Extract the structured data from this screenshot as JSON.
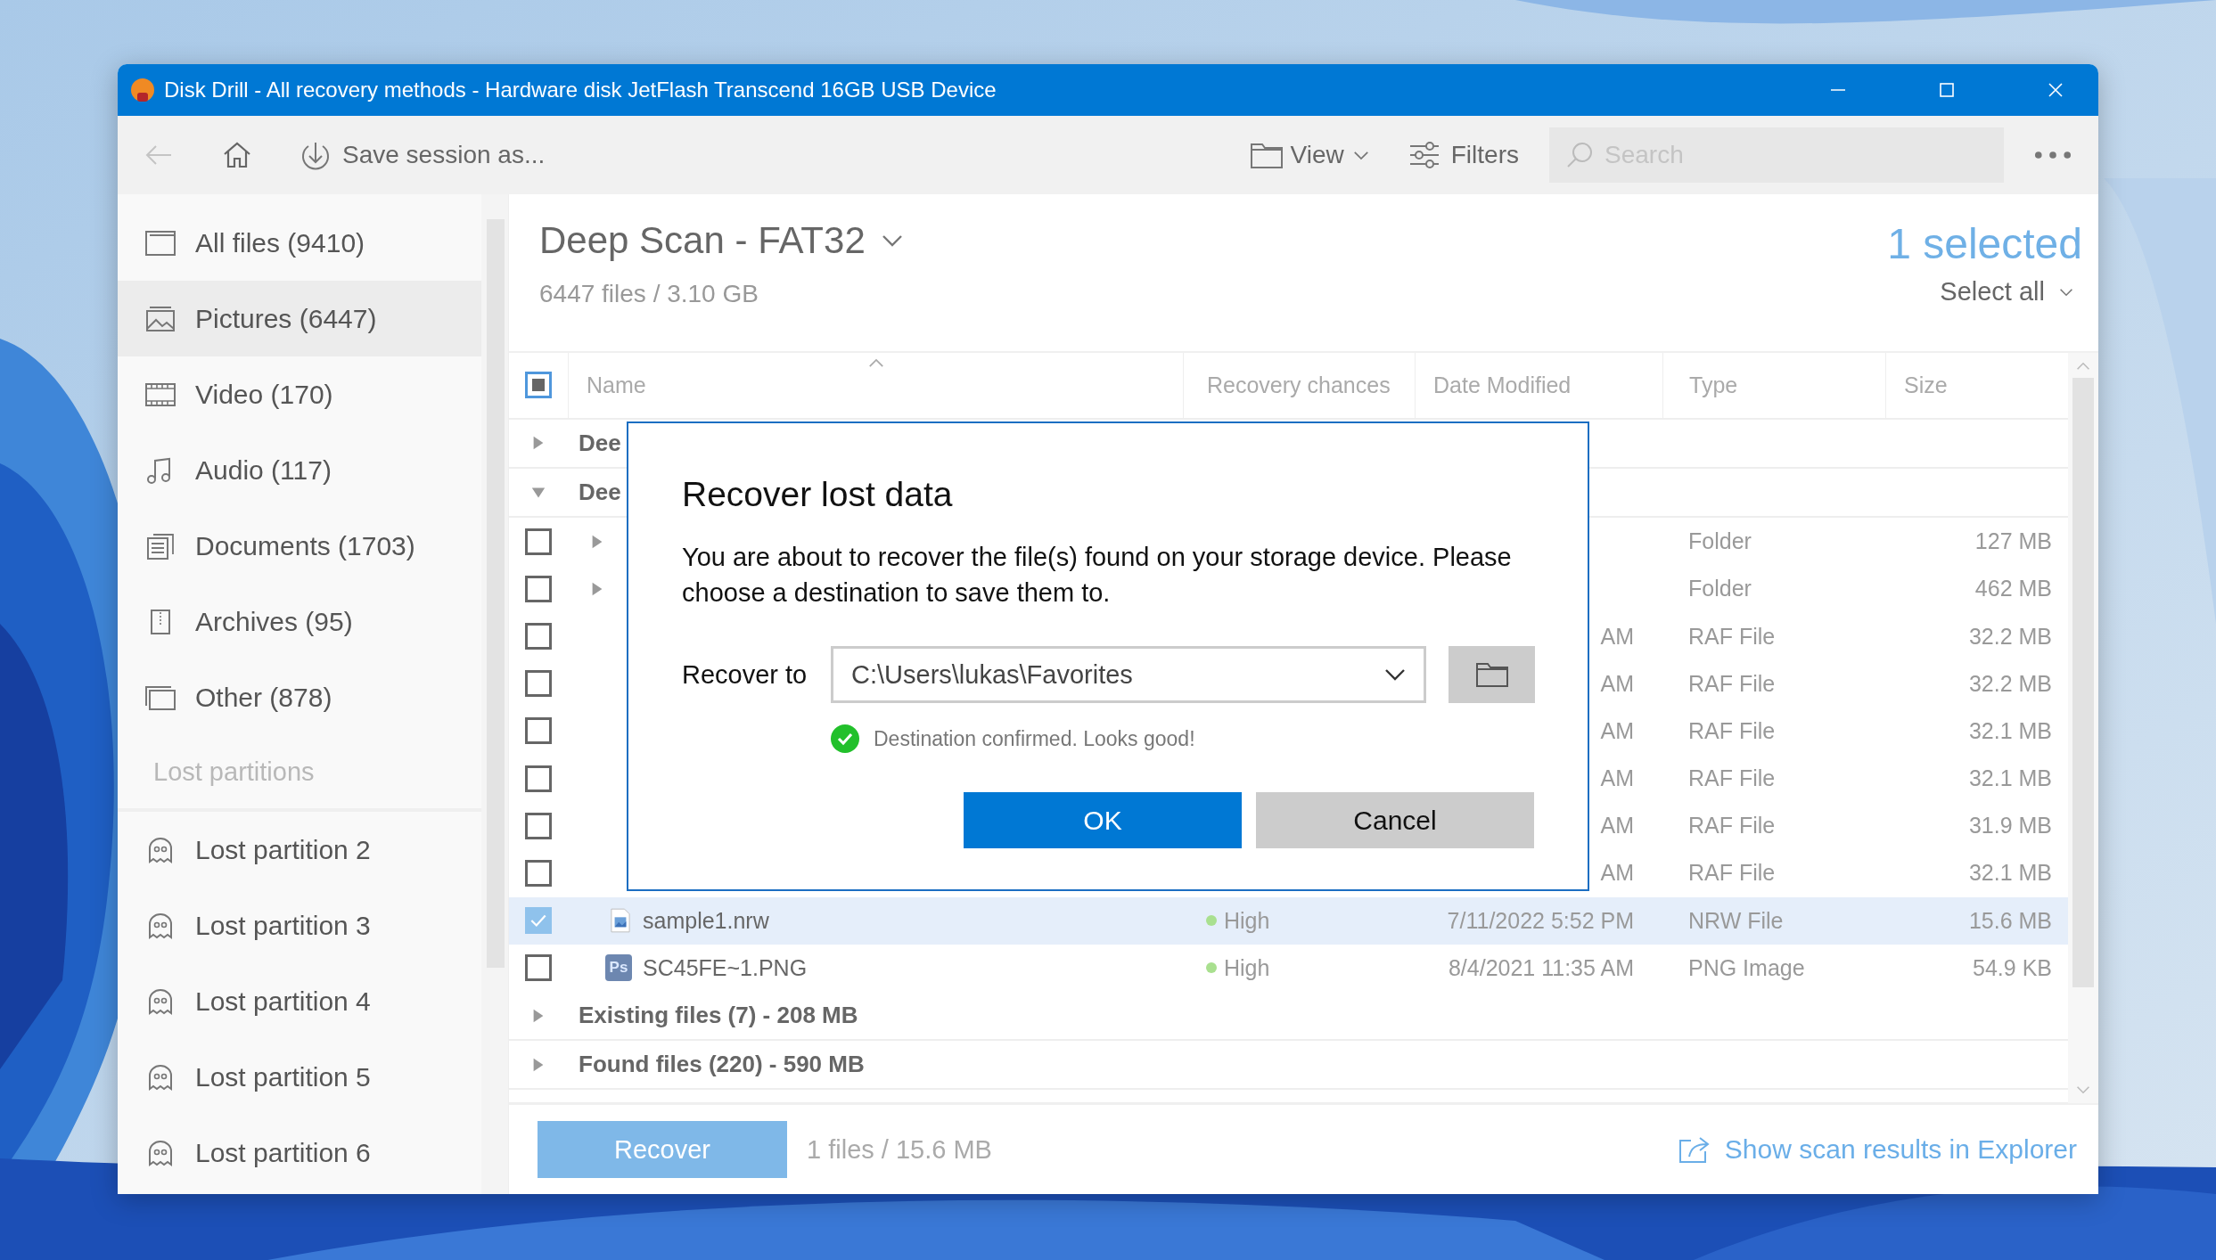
{
  "window": {
    "title": "Disk Drill - All recovery methods - Hardware disk JetFlash Transcend 16GB USB Device"
  },
  "toolbar": {
    "save_session": "Save session as...",
    "view": "View",
    "filters": "Filters",
    "search": {
      "placeholder": "Search"
    }
  },
  "sidebar": {
    "items": [
      {
        "kind": "all",
        "label": "All files (9410)",
        "selected": false
      },
      {
        "kind": "pictures",
        "label": "Pictures (6447)",
        "selected": true
      },
      {
        "kind": "video",
        "label": "Video (170)",
        "selected": false
      },
      {
        "kind": "audio",
        "label": "Audio (117)",
        "selected": false
      },
      {
        "kind": "documents",
        "label": "Documents (1703)",
        "selected": false
      },
      {
        "kind": "archives",
        "label": "Archives (95)",
        "selected": false
      },
      {
        "kind": "other",
        "label": "Other (878)",
        "selected": false
      }
    ],
    "section": "Lost partitions",
    "partitions": [
      {
        "label": "Lost partition 2"
      },
      {
        "label": "Lost partition 3"
      },
      {
        "label": "Lost partition 4"
      },
      {
        "label": "Lost partition 5"
      },
      {
        "label": "Lost partition 6"
      }
    ]
  },
  "scan": {
    "title": "Deep Scan - FAT32",
    "summary": "6447 files / 3.10 GB",
    "selected_count": "1 selected",
    "select_all": "Select all"
  },
  "table": {
    "header_indeterminate": true,
    "columns": [
      {
        "label": "Name",
        "sorted": true
      },
      {
        "label": "Recovery chances",
        "sorted": false
      },
      {
        "label": "Date Modified",
        "sorted": false
      },
      {
        "label": "Type",
        "sorted": false
      },
      {
        "label": "Size",
        "sorted": false
      }
    ],
    "rows": [
      {
        "kind": "group",
        "label": "Dee",
        "expanded": false
      },
      {
        "kind": "group",
        "label": "Dee",
        "expanded": true
      },
      {
        "kind": "folder",
        "checked": false,
        "selected": false,
        "type": "Folder",
        "size": "127 MB"
      },
      {
        "kind": "folder",
        "checked": false,
        "selected": false,
        "type": "Folder",
        "size": "462 MB"
      },
      {
        "kind": "file",
        "checked": false,
        "selected": false,
        "date": "AM",
        "type": "RAF File",
        "size": "32.2 MB"
      },
      {
        "kind": "file",
        "checked": false,
        "selected": false,
        "date": "AM",
        "type": "RAF File",
        "size": "32.2 MB"
      },
      {
        "kind": "file",
        "checked": false,
        "selected": false,
        "date": "AM",
        "type": "RAF File",
        "size": "32.1 MB"
      },
      {
        "kind": "file",
        "checked": false,
        "selected": false,
        "date": "AM",
        "type": "RAF File",
        "size": "32.1 MB"
      },
      {
        "kind": "file",
        "checked": false,
        "selected": false,
        "date": "AM",
        "type": "RAF File",
        "size": "31.9 MB"
      },
      {
        "kind": "file",
        "checked": false,
        "selected": false,
        "date": "AM",
        "type": "RAF File",
        "size": "32.1 MB"
      },
      {
        "kind": "file",
        "checked": true,
        "selected": true,
        "name": "sample1.nrw",
        "chance": "High",
        "date": "7/11/2022 5:52 PM",
        "type": "NRW File",
        "size": "15.6 MB"
      },
      {
        "kind": "file",
        "checked": false,
        "selected": false,
        "badge": "Ps",
        "name": "SC45FE~1.PNG",
        "chance": "High",
        "date": "8/4/2021 11:35 AM",
        "type": "PNG Image",
        "size": "54.9 KB"
      },
      {
        "kind": "group",
        "label": "Existing files (7) - 208 MB",
        "expanded": false
      },
      {
        "kind": "group",
        "label": "Found files (220) - 590 MB",
        "expanded": false
      }
    ]
  },
  "footer": {
    "recover": "Recover",
    "summary": "1 files / 15.6 MB",
    "explorer_link": "Show scan results in Explorer"
  },
  "dialog": {
    "title": "Recover lost data",
    "message": "You are about to recover the file(s) found on your storage device. Please choose a destination to save them to.",
    "recover_to_label": "Recover to",
    "path": "C:\\Users\\lukas\\Favorites",
    "status": "Destination confirmed. Looks good!",
    "ok": "OK",
    "cancel": "Cancel"
  }
}
